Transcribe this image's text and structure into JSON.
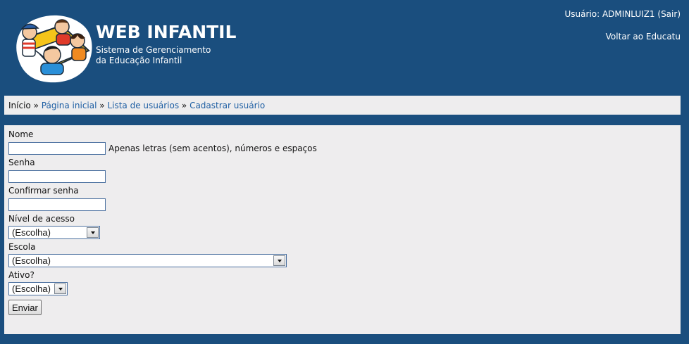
{
  "header": {
    "title": "WEB INFANTIL",
    "subtitle_line1": "Sistema de Gerenciamento",
    "subtitle_line2": "da Educação Infantil",
    "user_prefix": "Usuário: ADMINLUIZ1 (",
    "logout_label": "Sair",
    "user_suffix": ")",
    "back_link": "Voltar ao Educatu"
  },
  "breadcrumb": {
    "items": [
      {
        "label": "Início",
        "link": false
      },
      {
        "label": "Página inicial",
        "link": true
      },
      {
        "label": "Lista de usuários",
        "link": true
      },
      {
        "label": "Cadastrar usuário",
        "link": true
      }
    ],
    "separator": "»"
  },
  "form": {
    "nome": {
      "label": "Nome",
      "value": "",
      "hint": "Apenas letras (sem acentos), números e espaços"
    },
    "senha": {
      "label": "Senha",
      "value": ""
    },
    "confirmar": {
      "label": "Confirmar senha",
      "value": ""
    },
    "nivel": {
      "label": "Nível de acesso",
      "selected": "(Escolha)"
    },
    "escola": {
      "label": "Escola",
      "selected": "(Escolha)"
    },
    "ativo": {
      "label": "Ativo?",
      "selected": "(Escolha)"
    },
    "submit_label": "Enviar"
  },
  "colors": {
    "background": "#1a4e7e",
    "panel": "#eeedee",
    "link": "#1d5ea3"
  },
  "icons": {
    "logo": "children-logo"
  }
}
